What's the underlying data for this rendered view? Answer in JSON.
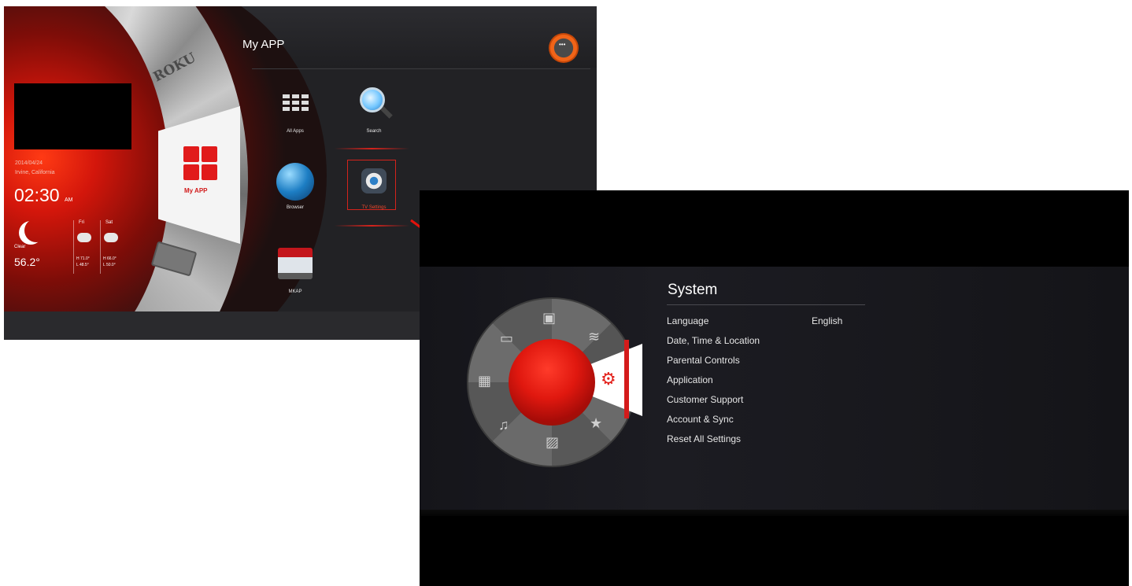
{
  "launcher": {
    "title": "My APP",
    "wheel": {
      "roku_label": "ROKU",
      "active_label": "My APP"
    },
    "clock_widget": {
      "date": "2014/04/24",
      "location": "Irvine,  California",
      "time": "02:30",
      "am_pm": "AM",
      "condition": "Clear",
      "temperature": "56.2°",
      "forecast": [
        {
          "day": "Fri",
          "high_low": "H 71.0°\nL 48.5°"
        },
        {
          "day": "Sat",
          "high_low": "H 66.0°\nL 50.0°"
        }
      ]
    },
    "apps": [
      {
        "name": "All Apps",
        "icon": "all-apps-grid-icon"
      },
      {
        "name": "Search",
        "icon": "magnifier-icon"
      },
      {
        "name": "Browser",
        "icon": "globe-icon"
      },
      {
        "name": "TV Settings",
        "icon": "gear-icon",
        "selected": true
      },
      {
        "name": "MKAP",
        "icon": "mkap-icon"
      }
    ],
    "exit_button_label": "•••"
  },
  "settings": {
    "title": "System",
    "items": [
      "Language",
      "Date, Time & Location",
      "Parental Controls",
      "Application",
      "Customer Support",
      "Account & Sync",
      "Reset All Settings"
    ],
    "language_value": "English",
    "wheel_icons": [
      "message-icon",
      "tv-icon",
      "wifi-icon",
      "gear-icon",
      "star-icon",
      "picture-icon",
      "music-icon",
      "film-icon"
    ]
  },
  "colors": {
    "accent_red": "#d4231c",
    "launcher_bg": "#222225",
    "settings_bg": "#000000"
  }
}
